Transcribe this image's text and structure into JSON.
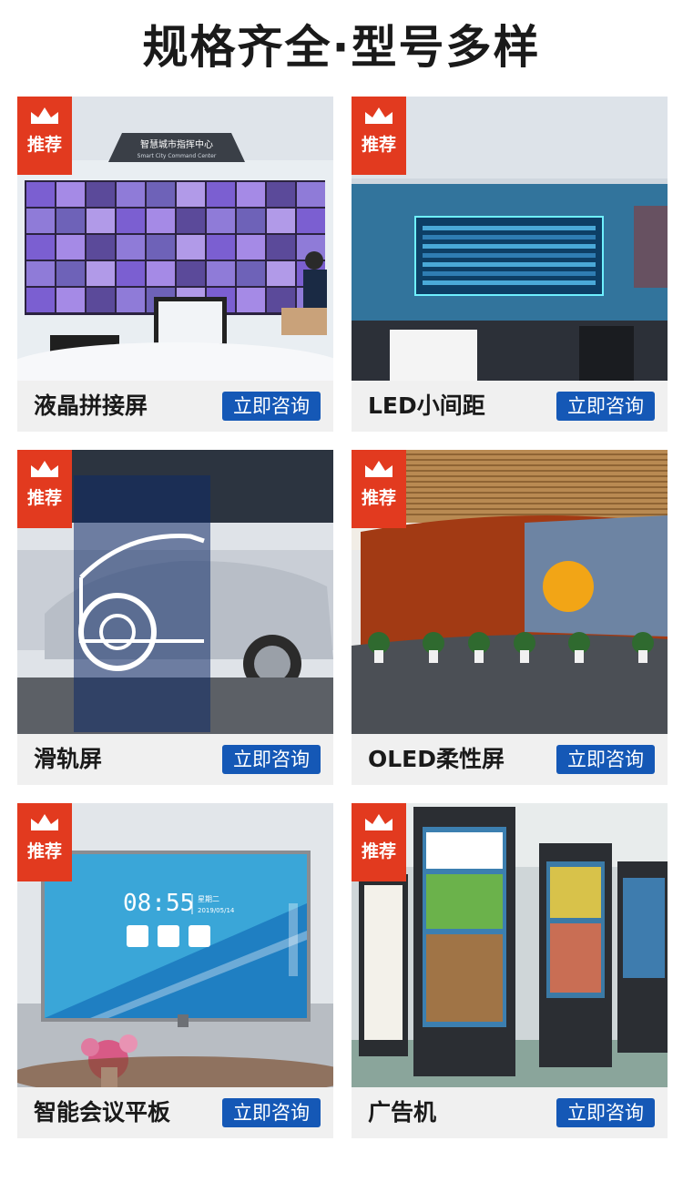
{
  "page_title": "规格齐全·型号多样",
  "badge_label": "推荐",
  "products": [
    {
      "name": "液晶拼接屏",
      "cta": "立即咨询",
      "scene_text": [
        "智慧城市指挥中心",
        "Smart City Command Center"
      ]
    },
    {
      "name": "LED小间距",
      "cta": "立即咨询"
    },
    {
      "name": "滑轨屏",
      "cta": "立即咨询"
    },
    {
      "name": "OLED柔性屏",
      "cta": "立即咨询"
    },
    {
      "name": "智能会议平板",
      "cta": "立即咨询",
      "scene_text": [
        "08:55",
        "星期二",
        "2019/05/14"
      ]
    },
    {
      "name": "广告机",
      "cta": "立即咨询"
    }
  ],
  "colors": {
    "badge": "#e23a1f",
    "cta": "#1558b6",
    "caption_bg": "#f0f0f0"
  }
}
